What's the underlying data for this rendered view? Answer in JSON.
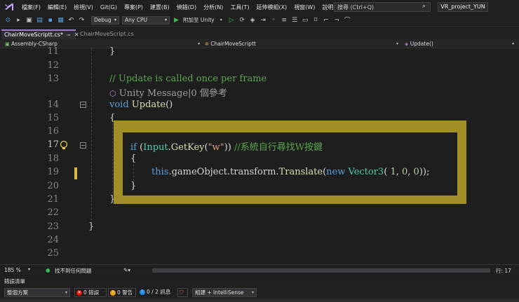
{
  "menu": {
    "items": [
      "檔案(F)",
      "編輯(E)",
      "檢視(V)",
      "Git(G)",
      "專案(P)",
      "建置(B)",
      "偵錯(D)",
      "分析(N)",
      "工具(T)",
      "延伸模組(X)",
      "視窗(W)",
      "說明(H)"
    ],
    "search_placeholder": "搜尋 (Ctrl+Q)",
    "project_name": "VR_project_YUN"
  },
  "toolbar": {
    "configuration": "Debug",
    "platform": "Any CPU",
    "attach_label": "附加至 Unity"
  },
  "tabs": [
    {
      "label": "ChairMoveScriptt.cs*",
      "active": true
    },
    {
      "label": "ChairMoveScript.cs",
      "active": false
    }
  ],
  "navbar": {
    "project": "Assembly-CSharp",
    "class": "ChairMoveScriptt",
    "member": "Update()"
  },
  "editor": {
    "line_numbers": [
      "11",
      "12",
      "13",
      "14",
      "15",
      "16",
      "17",
      "18",
      "19",
      "20",
      "21",
      "22",
      "23",
      "24",
      "25"
    ],
    "current_line": "17",
    "code": {
      "l11_brace": "}",
      "l13_comment": "// Update is called once per frame",
      "codelens": "Unity Message|0 個參考",
      "l14_void": "void",
      "l14_update": "Update",
      "l14_parens": "()",
      "l15_brace": "{",
      "l17_if": "if",
      "l17_open": " (",
      "l17_input": "Input",
      "l17_dot": ".",
      "l17_getkey": "GetKey",
      "l17_paren": "(",
      "l17_str": "\"w\"",
      "l17_close": ")) ",
      "l17_comment": "//系統自行尋找W按鍵",
      "l18_brace": "{",
      "l19_this": "this",
      "l19_chain": ".gameObject.transform.",
      "l19_translate": "Translate",
      "l19_paren": "(",
      "l19_new": "new",
      "l19_vector": "Vector3",
      "l19_args_open": "( ",
      "l19_n1": "1",
      "l19_comma1": ", ",
      "l19_n2": "0",
      "l19_comma2": ", ",
      "l19_n3": "0",
      "l19_end": "));",
      "l20_brace": "}",
      "l21_brace": "}",
      "l23_brace": "}"
    }
  },
  "status": {
    "zoom": "185 %",
    "issues": "找不到任何問題",
    "line_label": "行: 17"
  },
  "panel": {
    "title": "錯誤清單",
    "scope": "整個方案",
    "errors": "0 錯誤",
    "warnings": "0 警告",
    "messages": "0 / 2 訊息",
    "build_filter": "組建 + IntelliSense"
  },
  "colors": {
    "highlight": "#d6ba2a",
    "keyword": "#569cd6",
    "type": "#4ec9b0",
    "method": "#dcdcaa",
    "string": "#d69d85",
    "comment": "#57a64a",
    "number": "#b5cea8"
  }
}
